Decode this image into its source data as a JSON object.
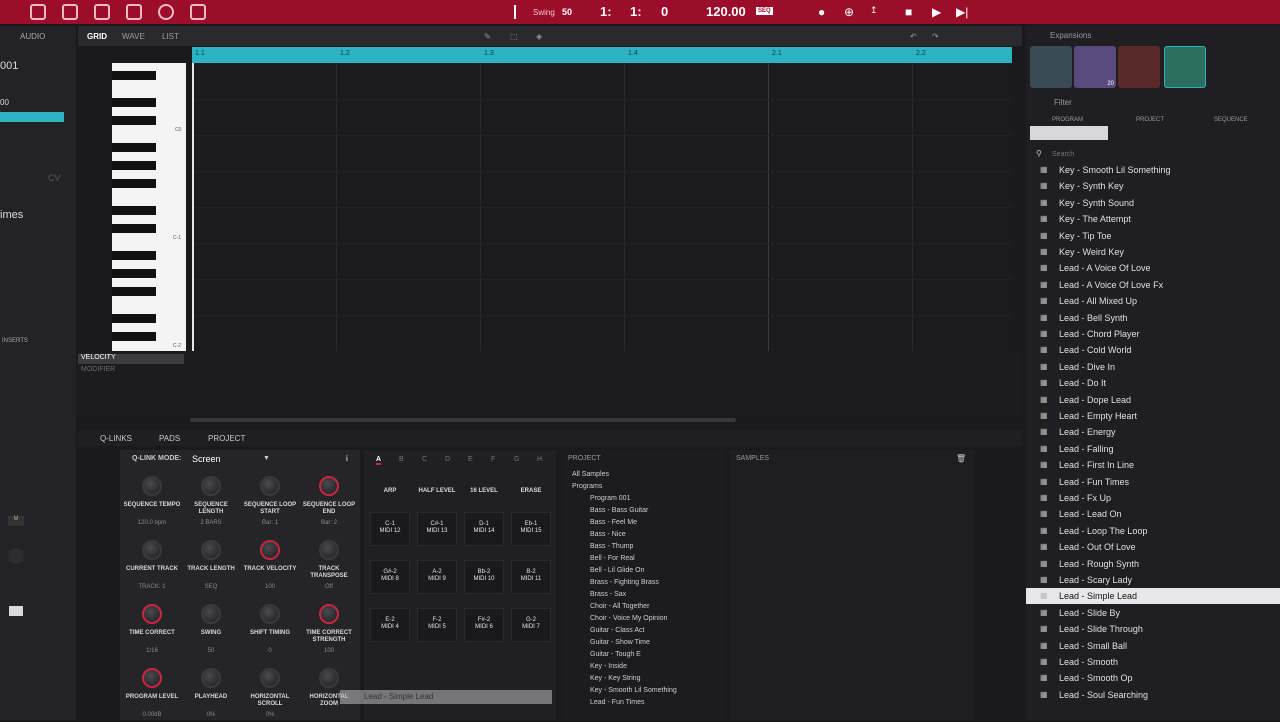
{
  "topbar": {
    "bpm": "120.00",
    "bpm_badge": "SEQ",
    "position": [
      "1:",
      "1:",
      "0"
    ],
    "swing_value": "50",
    "swing_label": "Swing"
  },
  "left": {
    "track_num": "001",
    "value_00": "00",
    "times_label": "imes",
    "inserts_label": "INSERTS",
    "cv_label": "CV",
    "mute_label": "M"
  },
  "main": {
    "tabs": [
      {
        "label": "GRID"
      },
      {
        "label": "WAVE"
      },
      {
        "label": "LIST"
      }
    ],
    "ruler": [
      "1.1",
      "1.2",
      "1.3",
      "1.4",
      "2.1",
      "2.2"
    ],
    "piano_labels": [
      "C0",
      "C-1",
      "C-2"
    ],
    "velocity_label": "VELOCITY",
    "modifier_label": "MODIFIER"
  },
  "bottom": {
    "tabs": [
      {
        "label": "Q-LINKS"
      },
      {
        "label": "PADS"
      },
      {
        "label": "PROJECT"
      }
    ],
    "qlink_mode_label": "Q-LINK MODE:",
    "qlink_mode_value": "Screen",
    "knobs": [
      {
        "label": "SEQUENCE TEMPO",
        "value": "120.0 bpm"
      },
      {
        "label": "SEQUENCE LENGTH",
        "value": "2 BARS"
      },
      {
        "label": "SEQUENCE LOOP START",
        "value": "Bar: 1"
      },
      {
        "label": "SEQUENCE LOOP END",
        "value": "Bar: 2"
      },
      {
        "label": "CURRENT TRACK",
        "value": "TRACK: 1"
      },
      {
        "label": "TRACK LENGTH",
        "value": "SEQ"
      },
      {
        "label": "TRACK VELOCITY",
        "value": "100"
      },
      {
        "label": "TRACK TRANSPOSE",
        "value": "Off"
      },
      {
        "label": "TIME CORRECT",
        "value": "1/16"
      },
      {
        "label": "SWING",
        "value": "50"
      },
      {
        "label": "SHIFT TIMING",
        "value": "0"
      },
      {
        "label": "TIME CORRECT STRENGTH",
        "value": "100"
      },
      {
        "label": "PROGRAM LEVEL",
        "value": "0.00dB"
      },
      {
        "label": "PLAYHEAD",
        "value": "0%"
      },
      {
        "label": "HORIZONTAL SCROLL",
        "value": "0%"
      },
      {
        "label": "HORIZONTAL ZOOM",
        "value": ""
      }
    ],
    "pad_banks": [
      "A",
      "B",
      "C",
      "D",
      "E",
      "F",
      "G",
      "H"
    ],
    "pad_buttons": [
      "ARP",
      "HALF LEVEL",
      "16 LEVEL",
      "ERASE"
    ],
    "pads": [
      [
        "C-1\nMIDI 12",
        "C#-1\nMIDI 13",
        "D-1\nMIDI 14",
        "Eb-1\nMIDI 15"
      ],
      [
        "G#-2\nMIDI 8",
        "A-2\nMIDI 9",
        "Bb-2\nMIDI 10",
        "B-2\nMIDI 11"
      ],
      [
        "E-2\nMIDI 4",
        "F-2\nMIDI 5",
        "F#-2\nMIDI 6",
        "G-2\nMIDI 7"
      ]
    ],
    "project_title": "PROJECT",
    "project_items": [
      "All Samples",
      "Programs",
      "Program 001",
      "Bass - Bass Guitar",
      "Bass - Feel Me",
      "Bass - Nice",
      "Bass - Thump",
      "Bell - For Real",
      "Bell - Lil Glide On",
      "Brass - Fighting Brass",
      "Brass - Sax",
      "Choir - All Together",
      "Choir - Voice My Opinion",
      "Guitar - Class Act",
      "Guitar - Show Time",
      "Guitar - Tough E",
      "Key - Inside",
      "Key - Key String",
      "Key - Smooth Lil Something",
      "Lead - Fun Times"
    ],
    "samples_title": "SAMPLES",
    "drag_label": "Lead - Simple Lead"
  },
  "right": {
    "expansions_label": "Expansions",
    "filter_label": "Filter",
    "filter_tabs": [
      "PROGRAM",
      "PROJECT",
      "SEQUENCE"
    ],
    "search_placeholder": "Search",
    "thumb_badge": "20",
    "list": [
      "Key - Smooth Lil Something",
      "Key - Synth Key",
      "Key - Synth Sound",
      "Key - The Attempt",
      "Key - Tip Toe",
      "Key - Weird Key",
      "Lead - A Voice Of Love",
      "Lead - A Voice Of Love Fx",
      "Lead - All Mixed Up",
      "Lead - Bell Synth",
      "Lead - Chord Player",
      "Lead - Cold World",
      "Lead - Dive In",
      "Lead - Do It",
      "Lead - Dope Lead",
      "Lead - Empty Heart",
      "Lead - Energy",
      "Lead - Falling",
      "Lead - First In Line",
      "Lead - Fun Times",
      "Lead - Fx Up",
      "Lead - Lead On",
      "Lead - Loop The Loop",
      "Lead - Out Of Love",
      "Lead - Rough Synth",
      "Lead - Scary Lady",
      "Lead - Simple Lead",
      "Lead - Slide By",
      "Lead - Slide Through",
      "Lead - Small Ball",
      "Lead - Smooth",
      "Lead - Smooth Op",
      "Lead - Soul Searching"
    ],
    "selected": "Lead - Simple Lead"
  },
  "colors": {
    "accent": "#2bb3c4",
    "topbar": "#9b0d2a",
    "knob_red": "#c8253e"
  }
}
